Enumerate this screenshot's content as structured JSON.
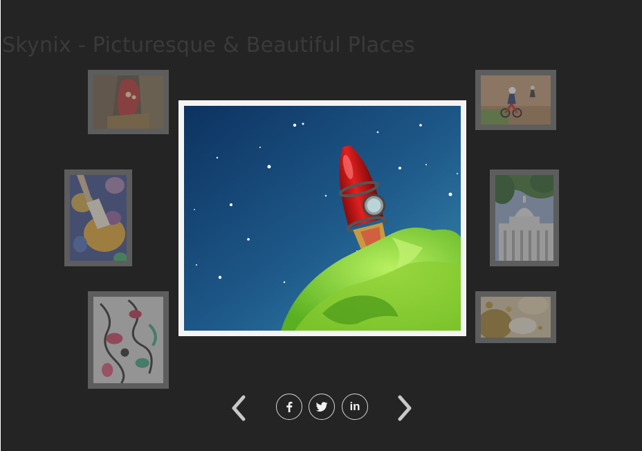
{
  "gallery": {
    "title": "Skynix - Picturesque & Beautiful Places"
  },
  "thumbnails": [
    {
      "name": "tribal-mask",
      "side": "left"
    },
    {
      "name": "paintbrush-watercolors",
      "side": "left"
    },
    {
      "name": "doodle-art",
      "side": "left"
    },
    {
      "name": "motocross-riders",
      "side": "right"
    },
    {
      "name": "capitol-building",
      "side": "right"
    },
    {
      "name": "autumn-puddle",
      "side": "right"
    }
  ],
  "featured": {
    "name": "red-rocket-green-planet"
  },
  "navigation": {
    "prev_icon": "chevron-left-icon",
    "next_icon": "chevron-right-icon"
  },
  "social": [
    {
      "network": "facebook",
      "icon": "facebook-icon"
    },
    {
      "network": "twitter",
      "icon": "twitter-icon"
    },
    {
      "network": "linkedin",
      "icon": "linkedin-icon",
      "text": "in"
    }
  ],
  "colors": {
    "background": "#242424",
    "frame": "#f4f4f4",
    "thumb_frame": "#5d5d5d",
    "icon": "#d8d8d8"
  }
}
